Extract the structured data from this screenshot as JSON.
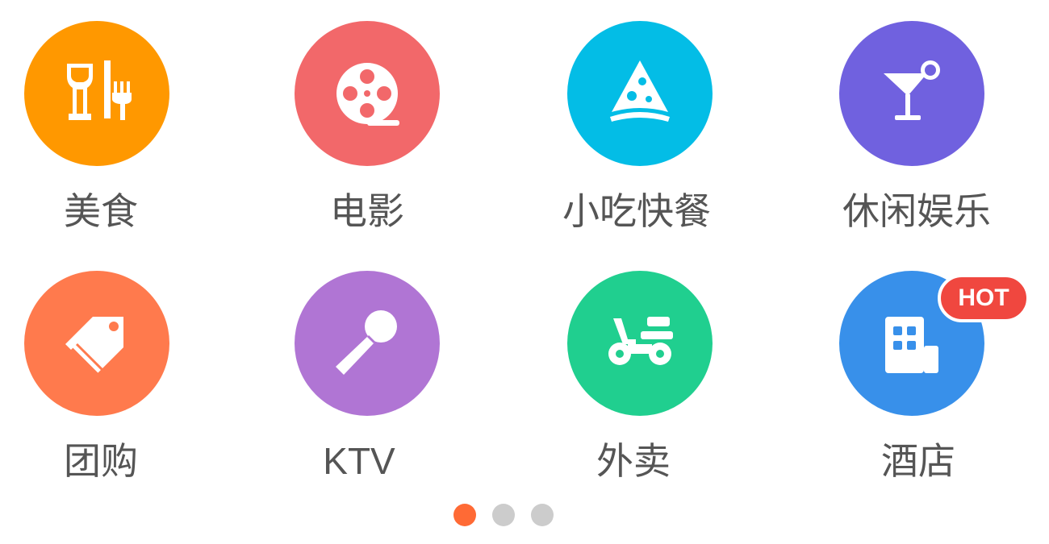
{
  "categories": [
    {
      "label": "美食",
      "color": "#ff9800",
      "icon": "food-drink-icon"
    },
    {
      "label": "电影",
      "color": "#f2686a",
      "icon": "film-reel-icon"
    },
    {
      "label": "小吃快餐",
      "color": "#03bde6",
      "icon": "pizza-slice-icon"
    },
    {
      "label": "休闲娱乐",
      "color": "#7061df",
      "icon": "cocktail-icon"
    },
    {
      "label": "团购",
      "color": "#ff7a4d",
      "icon": "price-tag-icon"
    },
    {
      "label": "KTV",
      "color": "#b075d4",
      "icon": "microphone-icon"
    },
    {
      "label": "外卖",
      "color": "#20cf8f",
      "icon": "scooter-icon"
    },
    {
      "label": "酒店",
      "color": "#3890ea",
      "icon": "hotel-building-icon"
    }
  ],
  "hot_badge": "HOT",
  "pagination": {
    "active_color": "#ff6a35",
    "inactive_color": "#cccccc",
    "pages": 3,
    "current": 1
  }
}
